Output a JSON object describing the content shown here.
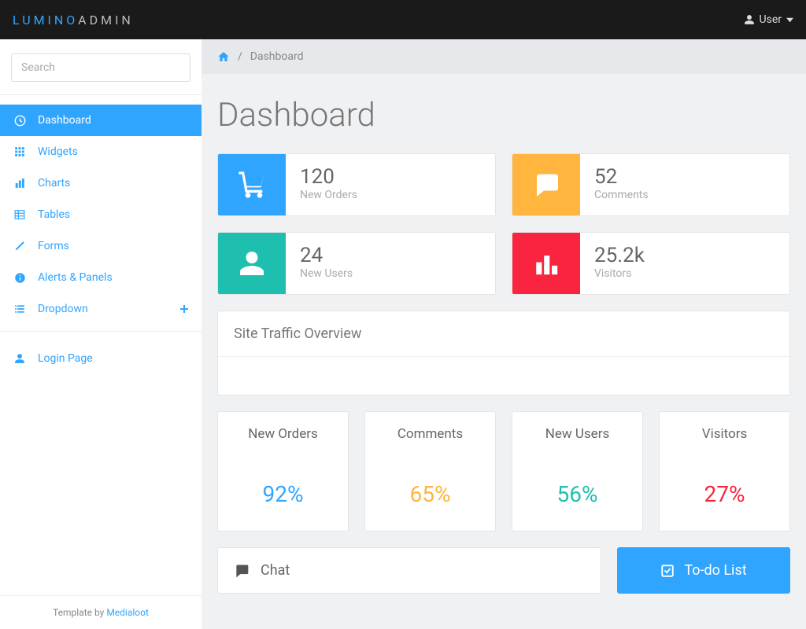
{
  "brand": {
    "part1": "LUMINO",
    "part2": "ADMIN"
  },
  "user": {
    "label": "User"
  },
  "search": {
    "placeholder": "Search"
  },
  "sidebar": {
    "items": [
      {
        "label": "Dashboard"
      },
      {
        "label": "Widgets"
      },
      {
        "label": "Charts"
      },
      {
        "label": "Tables"
      },
      {
        "label": "Forms"
      },
      {
        "label": "Alerts & Panels"
      },
      {
        "label": "Dropdown"
      }
    ],
    "secondary": [
      {
        "label": "Login Page"
      }
    ],
    "footer_prefix": "Template by ",
    "footer_link": "Medialoot"
  },
  "breadcrumb": {
    "current": "Dashboard"
  },
  "page": {
    "title": "Dashboard"
  },
  "stats": [
    {
      "value": "120",
      "label": "New Orders"
    },
    {
      "value": "52",
      "label": "Comments"
    },
    {
      "value": "24",
      "label": "New Users"
    },
    {
      "value": "25.2k",
      "label": "Visitors"
    }
  ],
  "traffic_panel": {
    "title": "Site Traffic Overview"
  },
  "percent": [
    {
      "title": "New Orders",
      "value": "92%"
    },
    {
      "title": "Comments",
      "value": "65%"
    },
    {
      "title": "New Users",
      "value": "56%"
    },
    {
      "title": "Visitors",
      "value": "27%"
    }
  ],
  "chat": {
    "title": "Chat"
  },
  "todo": {
    "title": "To-do List"
  }
}
